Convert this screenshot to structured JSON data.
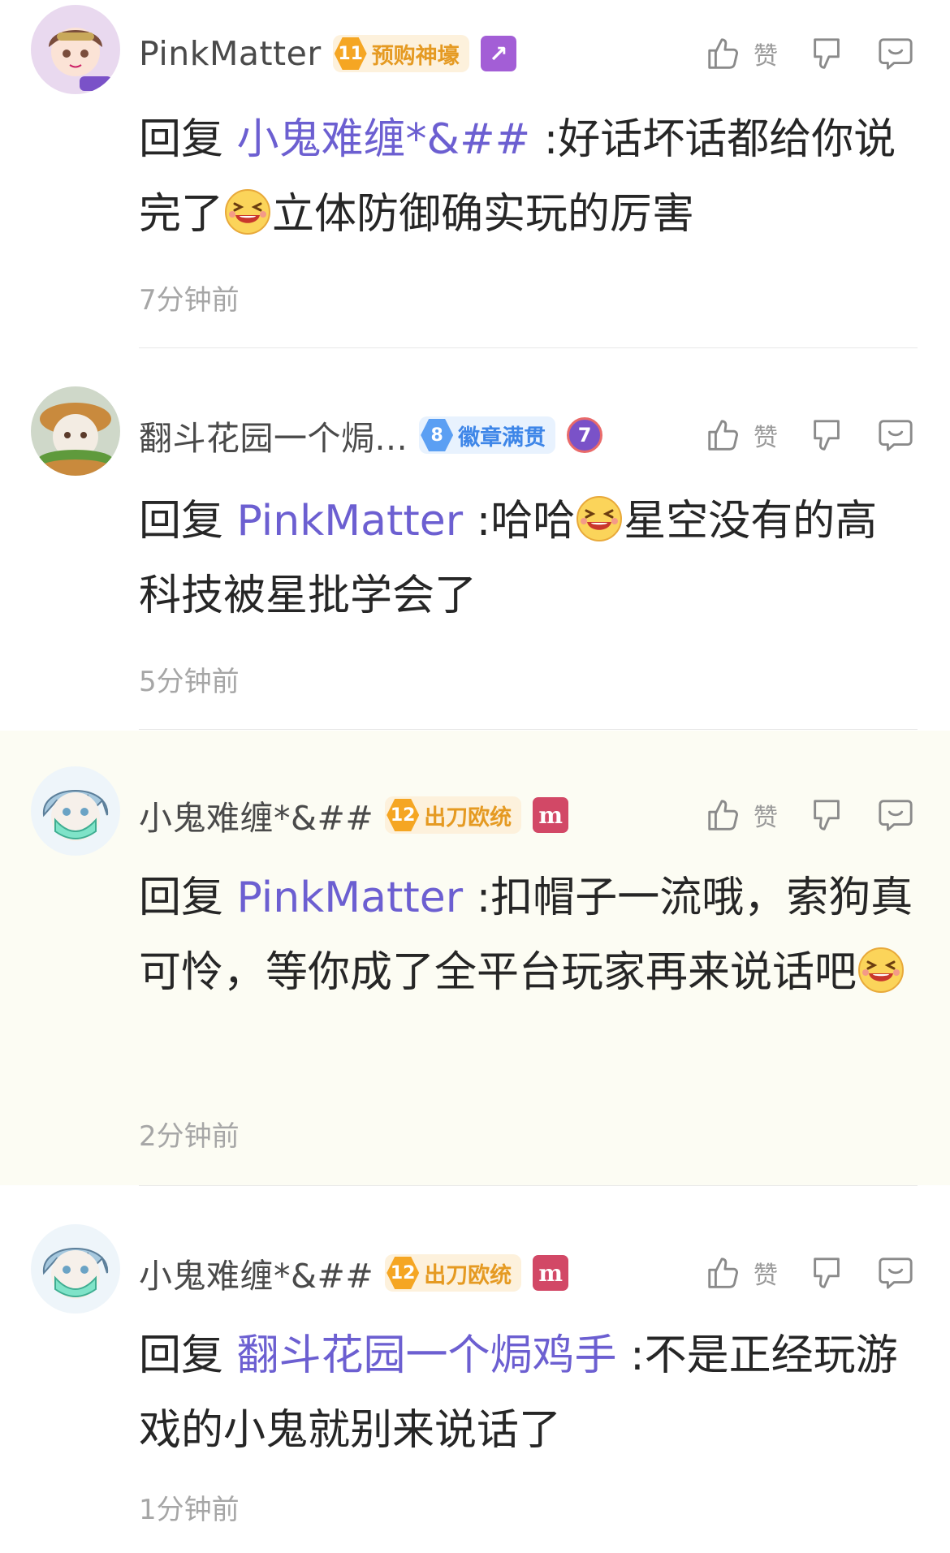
{
  "comments": [
    {
      "username": "PinkMatter",
      "badge": {
        "level": "11",
        "text": "预购神壕",
        "color": "#f5a623"
      },
      "extra_icon": "arrow-icon",
      "like_label": "赞",
      "reply_prefix": "回复",
      "reply_to": "小鬼难缠*&##",
      "text_before": ":好话坏话都给你说完了",
      "emoji": "laughing-emoji",
      "text_after": "立体防御确实玩的厉害",
      "time": "7分钟前"
    },
    {
      "username": "翻斗花园一个焗...",
      "badge": {
        "level": "8",
        "text": "徽章满贯",
        "color": "#5b9ff3"
      },
      "extra_icon": "medal-7-icon",
      "extra_text": "7",
      "like_label": "赞",
      "reply_prefix": "回复",
      "reply_to": "PinkMatter",
      "text_before": ":哈哈",
      "emoji": "laughing-emoji",
      "text_after": "星空没有的高科技被星批学会了",
      "time": "5分钟前"
    },
    {
      "username": "小鬼难缠*&##",
      "badge": {
        "level": "12",
        "text": "出刀欧统",
        "color": "#f5a623"
      },
      "extra_icon": "m-icon",
      "extra_text": "m",
      "like_label": "赞",
      "reply_prefix": "回复",
      "reply_to": "PinkMatter",
      "text_before": ":扣帽子一流哦，索狗真可怜，等你成了全平台玩家再来说话吧",
      "emoji": "laughing-emoji",
      "text_after": "",
      "time": "2分钟前"
    },
    {
      "username": "小鬼难缠*&##",
      "badge": {
        "level": "12",
        "text": "出刀欧统",
        "color": "#f5a623"
      },
      "extra_icon": "m-icon",
      "extra_text": "m",
      "like_label": "赞",
      "reply_prefix": "回复",
      "reply_to": "翻斗花园一个焗鸡手",
      "text_before": ":不是正经玩游戏的小鬼就别来说话了",
      "emoji": "",
      "text_after": "",
      "time": "1分钟前"
    }
  ],
  "colors": {
    "mention": "#6c5fd1",
    "highlight_bg": "#fcfcf3",
    "time": "#a6a6a6"
  }
}
